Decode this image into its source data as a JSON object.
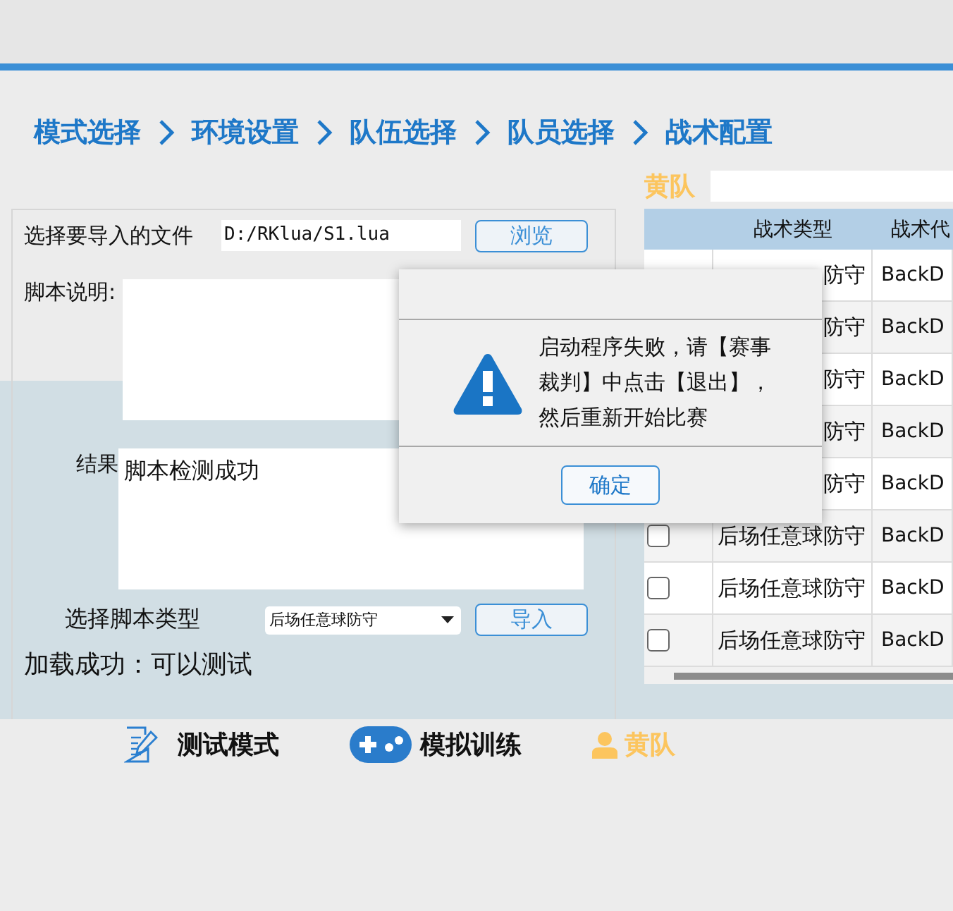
{
  "breadcrumb": [
    "模式选择",
    "环境设置",
    "队伍选择",
    "队员选择",
    "战术配置"
  ],
  "import_panel": {
    "file_label": "选择要导入的文件",
    "file_path": "D:/RKlua/S1.lua",
    "browse_button": "浏览",
    "description_label": "脚本说明:",
    "result_label": "结果",
    "result_text": "脚本检测成功",
    "type_label": "选择脚本类型",
    "type_value": "后场任意球防守",
    "import_button": "导入",
    "status": "加载成功：可以测试"
  },
  "team": {
    "name": "黄队"
  },
  "table": {
    "columns": [
      "战术类型",
      "战术代"
    ],
    "rows": [
      {
        "type": "防守",
        "code": "BackD"
      },
      {
        "type": "防守",
        "code": "BackD"
      },
      {
        "type": "防守",
        "code": "BackD"
      },
      {
        "type": "防守",
        "code": "BackD"
      },
      {
        "type": "防守",
        "code": "BackD"
      },
      {
        "checked": false,
        "type": "后场任意球防守",
        "code": "BackD"
      },
      {
        "checked": false,
        "type": "后场任意球防守",
        "code": "BackD"
      },
      {
        "checked": false,
        "type": "后场任意球防守",
        "code": "BackD"
      }
    ]
  },
  "toolbar": [
    {
      "kind": "test",
      "label": "测试模式"
    },
    {
      "kind": "train",
      "label": "模拟训练"
    },
    {
      "kind": "team",
      "label": "黄队"
    }
  ],
  "dialog": {
    "message": "启动程序失败，请【赛事裁判】中点击【退出】，然后重新开始比赛",
    "ok_button": "确定"
  }
}
